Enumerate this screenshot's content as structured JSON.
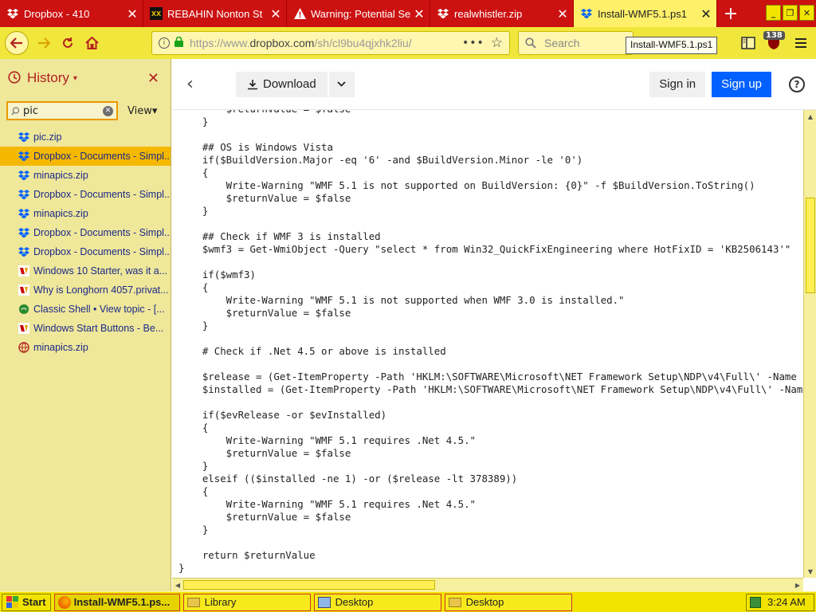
{
  "tabs": [
    {
      "title": "Dropbox - 410",
      "icon": "dropbox-icon",
      "active": false
    },
    {
      "title": "REBAHIN Nonton St",
      "icon": "rebahin-icon",
      "active": false
    },
    {
      "title": "Warning: Potential Se",
      "icon": "warning-icon",
      "active": false
    },
    {
      "title": "realwhistler.zip",
      "icon": "dropbox-icon",
      "active": false
    },
    {
      "title": "Install-WMF5.1.ps1",
      "icon": "dropbox-icon",
      "active": true
    }
  ],
  "nav": {
    "url_prefix": "https://www.",
    "url_domain": "dropbox.com",
    "url_rest": "/sh/cl9bu4qjxhk2liu/",
    "search_placeholder": "Search",
    "tooltip": "Install-WMF5.1.ps1",
    "badge_count": "138"
  },
  "sidebar": {
    "title": "History",
    "search_value": "pic",
    "view_label": "View",
    "items": [
      {
        "label": "pic.zip",
        "icon": "dropbox-icon"
      },
      {
        "label": "Dropbox - Documents - Simpl...",
        "icon": "dropbox-icon",
        "selected": true
      },
      {
        "label": "minapics.zip",
        "icon": "dropbox-icon"
      },
      {
        "label": "Dropbox - Documents - Simpl...",
        "icon": "dropbox-icon"
      },
      {
        "label": "minapics.zip",
        "icon": "dropbox-icon"
      },
      {
        "label": "Dropbox - Documents - Simpl...",
        "icon": "dropbox-icon"
      },
      {
        "label": "Dropbox - Documents - Simpl...",
        "icon": "dropbox-icon"
      },
      {
        "label": "Windows 10 Starter, was it a...",
        "icon": "betaarchive-icon"
      },
      {
        "label": "Why is Longhorn 4057.privat...",
        "icon": "betaarchive-icon"
      },
      {
        "label": "Classic Shell • View topic - [...",
        "icon": "classicshell-icon"
      },
      {
        "label": "Windows Start Buttons - Be...",
        "icon": "betaarchive-icon"
      },
      {
        "label": "minapics.zip",
        "icon": "globe-icon"
      }
    ]
  },
  "dropbox": {
    "download_label": "Download",
    "signin_label": "Sign in",
    "signup_label": "Sign up",
    "help_label": "?"
  },
  "code": "        $returnValue = $false\n    }\n\n    ## OS is Windows Vista\n    if($BuildVersion.Major -eq '6' -and $BuildVersion.Minor -le '0')\n    {\n        Write-Warning \"WMF 5.1 is not supported on BuildVersion: {0}\" -f $BuildVersion.ToString()\n        $returnValue = $false\n    }\n\n    ## Check if WMF 3 is installed\n    $wmf3 = Get-WmiObject -Query \"select * from Win32_QuickFixEngineering where HotFixID = 'KB2506143'\"\n\n    if($wmf3)\n    {\n        Write-Warning \"WMF 5.1 is not supported when WMF 3.0 is installed.\"\n        $returnValue = $false\n    }\n\n    # Check if .Net 4.5 or above is installed\n\n    $release = (Get-ItemProperty -Path 'HKLM:\\SOFTWARE\\Microsoft\\NET Framework Setup\\NDP\\v4\\Full\\' -Name Release -ErrorAction SilentlyContinue).Release\n    $installed = (Get-ItemProperty -Path 'HKLM:\\SOFTWARE\\Microsoft\\NET Framework Setup\\NDP\\v4\\Full\\' -Name Install -ErrorAction SilentlyContinue).Install\n\n    if($evRelease -or $evInstalled)\n    {\n        Write-Warning \"WMF 5.1 requires .Net 4.5.\"\n        $returnValue = $false\n    }\n    elseif (($installed -ne 1) -or ($release -lt 378389))\n    {\n        Write-Warning \"WMF 5.1 requires .Net 4.5.\"\n        $returnValue = $false\n    }\n\n    return $returnValue\n}",
  "taskbar": {
    "start_label": "Start",
    "tasks": [
      {
        "label": "Install-WMF5.1.ps...",
        "icon": "firefox-icon",
        "active": true
      },
      {
        "label": "Library",
        "icon": "folder-icon",
        "active": false
      },
      {
        "label": "Desktop",
        "icon": "desktop-icon",
        "active": false
      },
      {
        "label": "Desktop",
        "icon": "folder-icon",
        "active": false
      }
    ],
    "clock": "3:24 AM"
  },
  "colors": {
    "tab_red": "#cc1111",
    "toolbar_yellow": "#f1e63b",
    "sidebar_bg": "#efe79a",
    "selected": "#f5b800",
    "dropbox_blue": "#0061fe"
  }
}
